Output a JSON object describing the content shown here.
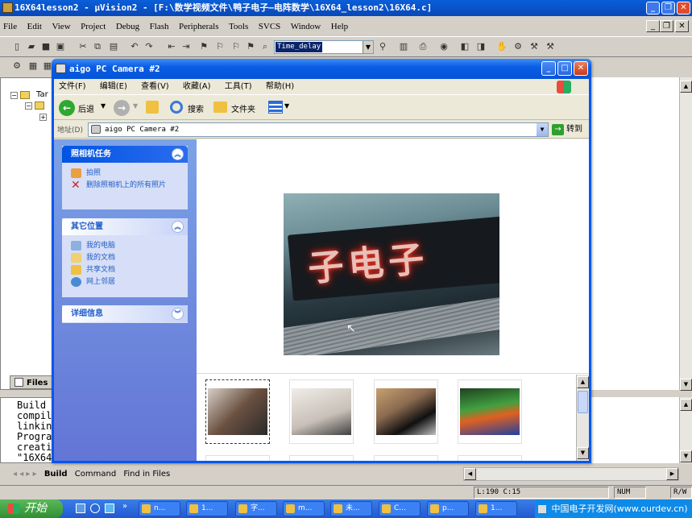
{
  "keil": {
    "title": "16X64lesson2  - µVision2 - [F:\\数学视频文件\\鸭子电子—电阵数学\\16X64_lesson2\\16X64.c]",
    "menu": [
      "File",
      "Edit",
      "View",
      "Project",
      "Debug",
      "Flash",
      "Peripherals",
      "Tools",
      "SVCS",
      "Window",
      "Help"
    ],
    "toolbar_combo": "Time_delay",
    "tree_label": "Tar",
    "files_tab": "Files",
    "output_lines": [
      "Build",
      "compil",
      "linkin",
      "Progra",
      "creati",
      "\"16X64"
    ],
    "output_tabs": [
      "Build",
      "Command",
      "Find in Files"
    ],
    "status": {
      "position": "L:190 C:15",
      "num": "NUM",
      "rw": "R/W"
    }
  },
  "explorer": {
    "title": "aigo PC Camera #2",
    "menu": [
      "文件(F)",
      "编辑(E)",
      "查看(V)",
      "收藏(A)",
      "工具(T)",
      "帮助(H)"
    ],
    "back_label": "后退",
    "search_label": "搜索",
    "folders_label": "文件夹",
    "address_label": "地址(D)",
    "address_value": "aigo PC Camera #2",
    "go_label": "转到",
    "camera_tasks": {
      "title": "照相机任务",
      "items": [
        "拍照",
        "删除照相机上的所有照片"
      ]
    },
    "other_places": {
      "title": "其它位置",
      "items": [
        "我的电脑",
        "我的文档",
        "共享文档",
        "网上邻居"
      ]
    },
    "details": {
      "title": "详细信息"
    },
    "preview_text": "子电子"
  },
  "taskbar": {
    "start_label": "开始",
    "items": [
      "n...",
      "1...",
      "字...",
      "m...",
      "未...",
      "C...",
      "p...",
      "1..."
    ],
    "tray_text": "中国电子开发网(www.ourdev.cn)"
  }
}
